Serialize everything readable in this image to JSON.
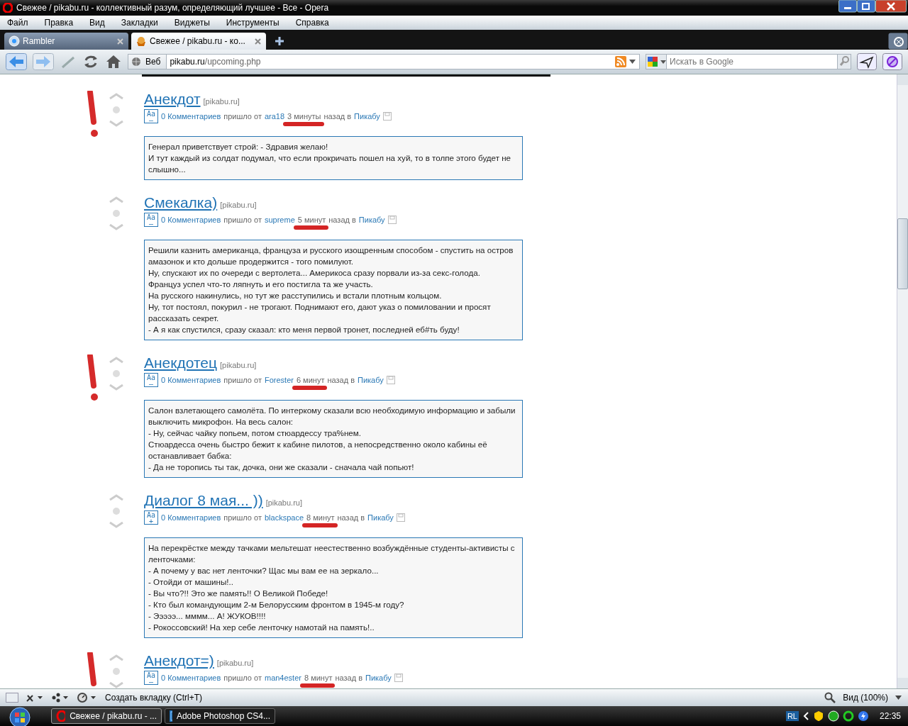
{
  "window": {
    "title": "Свежее / pikabu.ru - коллективный разум, определяющий лучшее - Все - Opera"
  },
  "menu": [
    "Файл",
    "Правка",
    "Вид",
    "Закладки",
    "Виджеты",
    "Инструменты",
    "Справка"
  ],
  "tabs": [
    {
      "label": "Rambler",
      "selected": false
    },
    {
      "label": "Свежее / pikabu.ru - ко...",
      "selected": true
    }
  ],
  "address": {
    "scope": "Веб",
    "domain": "pikabu.ru",
    "path": "/upcoming.php"
  },
  "search": {
    "placeholder": "Искать в Google"
  },
  "posts": [
    {
      "title": "Анекдот",
      "source": "[pikabu.ru]",
      "font_label": "Aa",
      "font_sign": "–",
      "comments": "0 Комментариев",
      "came": "пришло от",
      "author": "ara18",
      "time": "3 минуты",
      "ago": "назад в",
      "category": "Пикабу",
      "flagged": true,
      "marked": true,
      "lines": [
        "Генерал приветствует строй: - Здравия желаю!",
        "И тут каждый из солдат подумал, что если прокричать пошел на хуй, то в толпе этого будет не слышно..."
      ]
    },
    {
      "title": "Смекалка)",
      "source": "[pikabu.ru]",
      "font_label": "Aa",
      "font_sign": "–",
      "comments": "0 Комментариев",
      "came": "пришло от",
      "author": "supreme",
      "time": "5 минут",
      "ago": "назад в",
      "category": "Пикабу",
      "flagged": false,
      "marked": true,
      "lines": [
        "Решили казнить американца, француза и русского изощренным способом - спустить на остров амазонок и кто дольше продержится - того помилуют.",
        "Ну, спускают их по очереди с вертолета... Америкоса сразу порвали из-за секс-голода.",
        "Француз успел что-то ляпнуть и его постигла та же участь.",
        "На русского накинулись, но тут же расступились и встали плотным кольцом.",
        "Ну, тот постоял, покурил - не трогают. Поднимают его, дают указ о помиловании и просят рассказать секрет.",
        "- А я как спустился, сразу сказал: кто меня первой тронет, последней еб#ть буду!"
      ]
    },
    {
      "title": "Анекдотец",
      "source": "[pikabu.ru]",
      "font_label": "Aa",
      "font_sign": "–",
      "comments": "0 Комментариев",
      "came": "пришло от",
      "author": "Forester",
      "time": "6 минут",
      "ago": "назад в",
      "category": "Пикабу",
      "flagged": true,
      "marked": true,
      "lines": [
        "Салон взлетающего самолёта. По интеркому сказали всю необходимую информацию и забыли выключить микрофон. На весь салон:",
        "- Ну, сейчас чайку попьем, потом стюардессу тра%нем.",
        "Стюардесса очень быстро бежит к кабине пилотов, а непосредственно около кабины её останавливает бабка:",
        "- Да не торопись ты так, дочка, они же сказали - сначала чай попьют!"
      ]
    },
    {
      "title": "Диалог 8 мая... ))",
      "source": "[pikabu.ru]",
      "font_label": "Aa",
      "font_sign": "+",
      "comments": "0 Комментариев",
      "came": "пришло от",
      "author": "blackspace",
      "time": "8 минут",
      "ago": "назад в",
      "category": "Пикабу",
      "flagged": false,
      "marked": true,
      "lines": [
        "На перекрёстке между тачками мельтешат неестественно возбуждённые студенты-активисты с ленточками:",
        "- А почему у вас нет ленточки? Щас мы вам ее на зеркало...",
        "- Отойди от машины!..",
        "- Вы что?!! Это же память!! О Великой Победе!",
        "- Кто был командующим 2-м Белорусским фронтом в 1945-м году?",
        "- Эээээ... мммм... А! ЖУКОВ!!!!",
        "- Рокоссовский! На хер себе ленточку намотай на память!.."
      ]
    },
    {
      "title": "Анекдот=)",
      "source": "[pikabu.ru]",
      "font_label": "Aa",
      "font_sign": "–",
      "comments": "0 Комментариев",
      "came": "пришло от",
      "author": "man4ester",
      "time": "8 минут",
      "ago": "назад в",
      "category": "Пикабу",
      "flagged": true,
      "marked": true
    }
  ],
  "status_bar": {
    "new_tab": "Создать вкладку (Ctrl+T)",
    "zoom": "Вид (100%)"
  },
  "taskbar": {
    "tasks": [
      {
        "label": "Свежее / pikabu.ru - ...",
        "selected": true
      },
      {
        "label": "Adobe Photoshop CS4...",
        "selected": false
      }
    ],
    "tray_label": "RL",
    "clock": "22:35"
  }
}
